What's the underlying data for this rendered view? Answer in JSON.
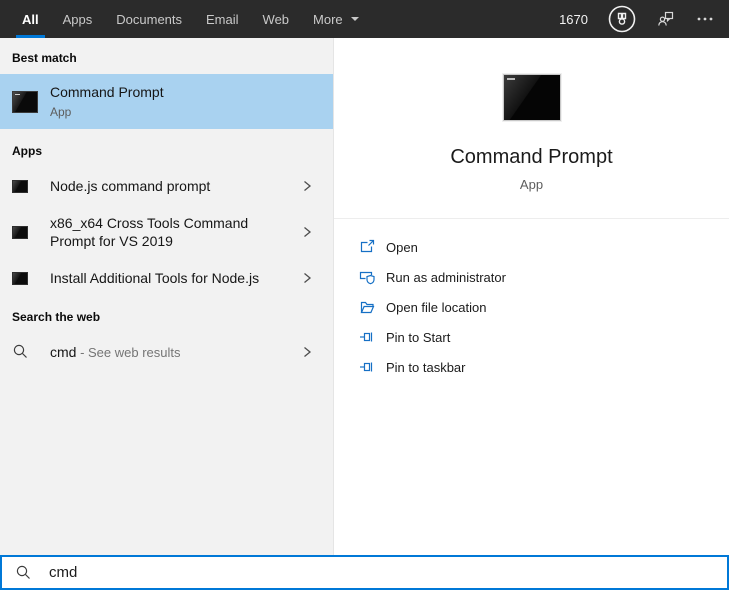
{
  "header": {
    "tabs": [
      {
        "label": "All",
        "active": true
      },
      {
        "label": "Apps",
        "active": false
      },
      {
        "label": "Documents",
        "active": false
      },
      {
        "label": "Email",
        "active": false
      },
      {
        "label": "Web",
        "active": false
      },
      {
        "label": "More",
        "active": false
      }
    ],
    "rewards_points": "1670"
  },
  "left_panel": {
    "best_match": {
      "section": "Best match",
      "title": "Command Prompt",
      "subtitle": "App"
    },
    "apps": {
      "section": "Apps",
      "items": [
        {
          "label": "Node.js command prompt"
        },
        {
          "label": "x86_x64 Cross Tools Command Prompt for VS 2019"
        },
        {
          "label": "Install Additional Tools for Node.js"
        }
      ]
    },
    "web": {
      "section": "Search the web",
      "query": "cmd",
      "suffix": " - See web results"
    }
  },
  "right_panel": {
    "title": "Command Prompt",
    "subtitle": "App",
    "actions": [
      {
        "label": "Open",
        "icon": "open-icon"
      },
      {
        "label": "Run as administrator",
        "icon": "shield-icon"
      },
      {
        "label": "Open file location",
        "icon": "folder-icon"
      },
      {
        "label": "Pin to Start",
        "icon": "pin-icon"
      },
      {
        "label": "Pin to taskbar",
        "icon": "pin-icon"
      }
    ]
  },
  "search_bar": {
    "value": "cmd"
  },
  "colors": {
    "accent_blue": "#0078d7",
    "highlight_blue": "#a9d2f0",
    "topbar_bg": "#2b2b2b",
    "action_icon_blue": "#1670c5"
  }
}
